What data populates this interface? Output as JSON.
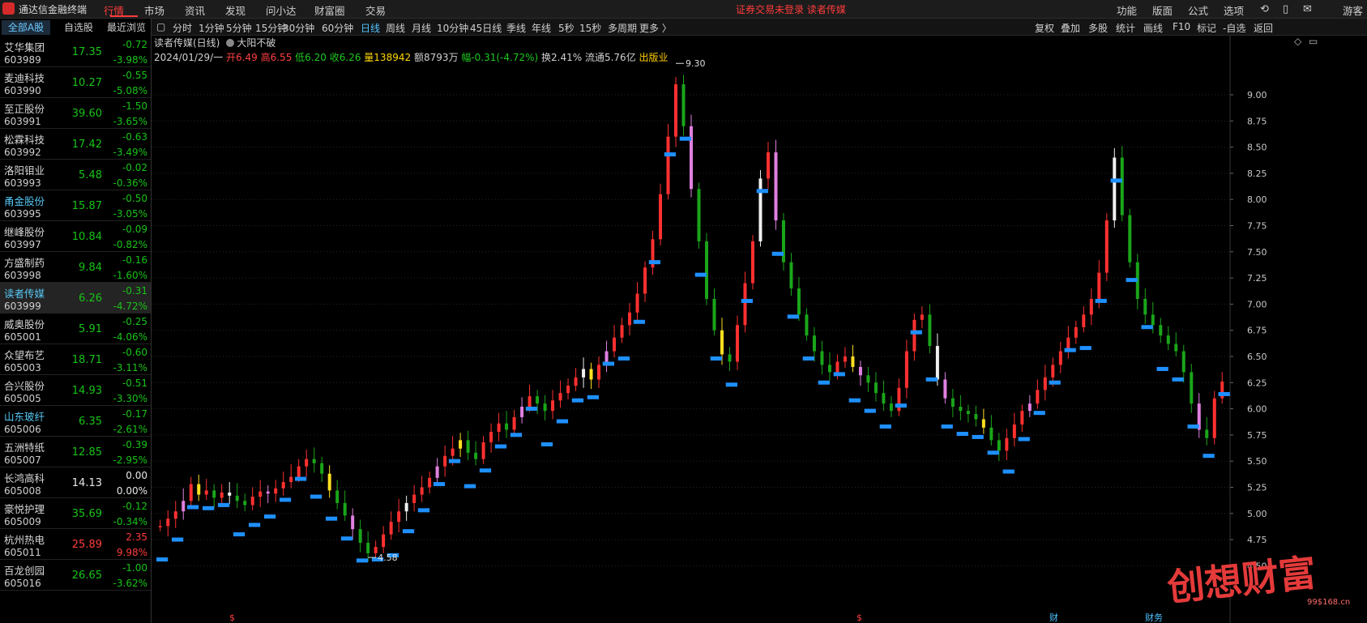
{
  "app": {
    "title": "通达信金融终端"
  },
  "menu": [
    "行情",
    "市场",
    "资讯",
    "发现",
    "问小达",
    "财富圈",
    "交易"
  ],
  "notice": "证券交易未登录  读者传媒",
  "right_menu": [
    "功能",
    "版面",
    "公式",
    "选项"
  ],
  "user": "游客",
  "left_tabs": [
    "全部A股",
    "自选股",
    "最近浏览"
  ],
  "stocks": [
    {
      "name": "艾华集团",
      "code": "603989",
      "price": "17.35",
      "chg": "-0.72",
      "pct": "-3.98%",
      "dir": "down"
    },
    {
      "name": "麦迪科技",
      "code": "603990",
      "price": "10.27",
      "chg": "-0.55",
      "pct": "-5.08%",
      "dir": "down"
    },
    {
      "name": "至正股份",
      "code": "603991",
      "price": "39.60",
      "chg": "-1.50",
      "pct": "-3.65%",
      "dir": "down"
    },
    {
      "name": "松霖科技",
      "code": "603992",
      "price": "17.42",
      "chg": "-0.63",
      "pct": "-3.49%",
      "dir": "down"
    },
    {
      "name": "洛阳钼业",
      "code": "603993",
      "price": "5.48",
      "chg": "-0.02",
      "pct": "-0.36%",
      "dir": "down"
    },
    {
      "name": "甬金股份",
      "code": "603995",
      "price": "15.87",
      "chg": "-0.50",
      "pct": "-3.05%",
      "dir": "down",
      "hl": true
    },
    {
      "name": "继峰股份",
      "code": "603997",
      "price": "10.84",
      "chg": "-0.09",
      "pct": "-0.82%",
      "dir": "down"
    },
    {
      "name": "方盛制药",
      "code": "603998",
      "price": "9.84",
      "chg": "-0.16",
      "pct": "-1.60%",
      "dir": "down"
    },
    {
      "name": "读者传媒",
      "code": "603999",
      "price": "6.26",
      "chg": "-0.31",
      "pct": "-4.72%",
      "dir": "down",
      "hl": true,
      "sel": true
    },
    {
      "name": "威奥股份",
      "code": "605001",
      "price": "5.91",
      "chg": "-0.25",
      "pct": "-4.06%",
      "dir": "down"
    },
    {
      "name": "众望布艺",
      "code": "605003",
      "price": "18.71",
      "chg": "-0.60",
      "pct": "-3.11%",
      "dir": "down"
    },
    {
      "name": "合兴股份",
      "code": "605005",
      "price": "14.93",
      "chg": "-0.51",
      "pct": "-3.30%",
      "dir": "down"
    },
    {
      "name": "山东玻纤",
      "code": "605006",
      "price": "6.35",
      "chg": "-0.17",
      "pct": "-2.61%",
      "dir": "down",
      "hl": true
    },
    {
      "name": "五洲特纸",
      "code": "605007",
      "price": "12.85",
      "chg": "-0.39",
      "pct": "-2.95%",
      "dir": "down"
    },
    {
      "name": "长鸿高科",
      "code": "605008",
      "price": "14.13",
      "chg": "0.00",
      "pct": "0.00%",
      "dir": "flat"
    },
    {
      "name": "豪悦护理",
      "code": "605009",
      "price": "35.69",
      "chg": "-0.12",
      "pct": "-0.34%",
      "dir": "down"
    },
    {
      "name": "杭州热电",
      "code": "605011",
      "price": "25.89",
      "chg": "2.35",
      "pct": "9.98%",
      "dir": "up"
    },
    {
      "name": "百龙创园",
      "code": "605016",
      "price": "26.65",
      "chg": "-1.00",
      "pct": "-3.62%",
      "dir": "down"
    }
  ],
  "timeframes": [
    "分时",
    "1分钟",
    "5分钟",
    "15分钟",
    "30分钟",
    "60分钟",
    "日线",
    "周线",
    "月线",
    "10分钟",
    "45日线",
    "季线",
    "年线",
    "5秒",
    "15秒",
    "多周期",
    "更多 〉"
  ],
  "active_timeframe": "日线",
  "tools": [
    "复权",
    "叠加",
    "多股",
    "统计",
    "画线",
    "F10",
    "标记",
    "-自选",
    "返回"
  ],
  "info": {
    "title": "读者传媒(日线)",
    "indicator": "大阳不破",
    "date": "2024/01/29/一",
    "open": "开6.49",
    "high": "高6.55",
    "low": "低6.20",
    "close": "收6.26",
    "volume": "量138942",
    "amount": "额8793万",
    "change": "幅-0.31(-4.72%)",
    "turnover": "换2.41%",
    "float": "流通5.76亿",
    "sector": "出版业"
  },
  "chart_data": {
    "type": "candlestick",
    "y_ticks": [
      "9.00",
      "8.75",
      "8.50",
      "8.25",
      "8.00",
      "7.75",
      "7.50",
      "7.25",
      "7.00",
      "6.75",
      "6.50",
      "6.25",
      "6.00",
      "5.75",
      "5.50",
      "5.25",
      "5.00",
      "4.75",
      "4.50"
    ],
    "ylim": [
      4.5,
      9.3
    ],
    "high_label": "9.30",
    "low_label": "4.58",
    "bottom_markers": [
      "$",
      "$",
      "财",
      "财务"
    ],
    "colors": {
      "up": "#ff3030",
      "down": "#1aa51a",
      "yellow": "#ffe020",
      "white": "#f0f0f0",
      "pink": "#e080e0",
      "blue": "#1e90ff",
      "grey": "#9a9a9a"
    },
    "closes": [
      4.88,
      4.95,
      5.02,
      5.12,
      5.28,
      5.18,
      5.22,
      5.15,
      5.2,
      5.17,
      5.12,
      5.08,
      5.16,
      5.21,
      5.19,
      5.24,
      5.3,
      5.35,
      5.45,
      5.52,
      5.48,
      5.38,
      5.22,
      5.1,
      4.98,
      4.85,
      4.72,
      4.62,
      4.68,
      4.8,
      4.92,
      5.02,
      5.1,
      5.18,
      5.25,
      5.34,
      5.45,
      5.55,
      5.62,
      5.7,
      5.58,
      5.52,
      5.68,
      5.78,
      5.86,
      5.8,
      5.92,
      6.02,
      6.12,
      6.05,
      5.98,
      6.08,
      6.15,
      6.22,
      6.3,
      6.38,
      6.28,
      6.42,
      6.55,
      6.68,
      6.8,
      6.92,
      7.1,
      7.35,
      7.62,
      8.05,
      8.6,
      9.1,
      8.7,
      8.1,
      7.6,
      7.05,
      6.75,
      6.52,
      6.45,
      6.8,
      7.2,
      7.6,
      8.2,
      8.45,
      7.8,
      7.4,
      7.15,
      6.9,
      6.7,
      6.55,
      6.42,
      6.35,
      6.45,
      6.5,
      6.4,
      6.32,
      6.25,
      6.15,
      6.05,
      5.98,
      6.2,
      6.55,
      6.85,
      6.9,
      6.6,
      6.28,
      6.1,
      6.02,
      5.98,
      5.95,
      5.9,
      5.82,
      5.7,
      5.6,
      5.72,
      5.85,
      5.98,
      6.05,
      6.18,
      6.3,
      6.42,
      6.55,
      6.68,
      6.78,
      6.9,
      7.05,
      7.3,
      7.8,
      8.4,
      7.85,
      7.4,
      7.05,
      6.9,
      6.8,
      6.7,
      6.62,
      6.55,
      6.35,
      6.05,
      5.8,
      5.72,
      6.1,
      6.26
    ]
  }
}
